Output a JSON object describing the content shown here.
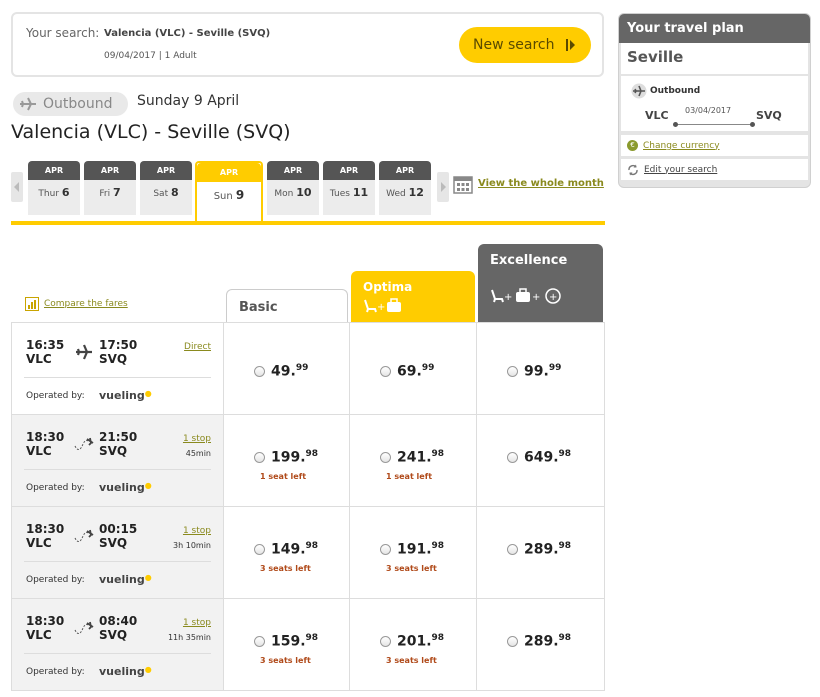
{
  "search": {
    "label": "Your search:",
    "route": "Valencia (VLC) - Seville (SVQ)",
    "meta": "09/04/2017 | 1 Adult",
    "new_search": "New search"
  },
  "outbound": {
    "pill": "Outbound",
    "date": "Sunday 9 April",
    "route_title": "Valencia (VLC) - Seville (SVQ)"
  },
  "days": [
    {
      "mon": "APR",
      "day": "Thur",
      "num": "6"
    },
    {
      "mon": "APR",
      "day": "Fri",
      "num": "7"
    },
    {
      "mon": "APR",
      "day": "Sat",
      "num": "8"
    },
    {
      "mon": "APR",
      "day": "Sun",
      "num": "9"
    },
    {
      "mon": "APR",
      "day": "Mon",
      "num": "10"
    },
    {
      "mon": "APR",
      "day": "Tues",
      "num": "11"
    },
    {
      "mon": "APR",
      "day": "Wed",
      "num": "12"
    }
  ],
  "whole_month": "View the whole month",
  "compare_fares": "Compare the fares",
  "fares": {
    "basic": "Basic",
    "optima": "Optima",
    "excellence": "Excellence"
  },
  "operated_by": "Operated by:",
  "airline": "vueling",
  "flights": [
    {
      "dep": "16:35",
      "from": "VLC",
      "arr": "17:50",
      "to": "SVQ",
      "stops": "Direct",
      "duration": "",
      "prices": [
        {
          "int": "49.",
          "dec": "99",
          "seats": ""
        },
        {
          "int": "69.",
          "dec": "99",
          "seats": ""
        },
        {
          "int": "99.",
          "dec": "99",
          "seats": ""
        }
      ]
    },
    {
      "dep": "18:30",
      "from": "VLC",
      "arr": "21:50",
      "to": "SVQ",
      "stops": "1 stop",
      "duration": "45min",
      "prices": [
        {
          "int": "199.",
          "dec": "98",
          "seats": "1 seat left"
        },
        {
          "int": "241.",
          "dec": "98",
          "seats": "1 seat left"
        },
        {
          "int": "649.",
          "dec": "98",
          "seats": ""
        }
      ]
    },
    {
      "dep": "18:30",
      "from": "VLC",
      "arr": "00:15",
      "to": "SVQ",
      "stops": "1 stop",
      "duration": "3h 10min",
      "prices": [
        {
          "int": "149.",
          "dec": "98",
          "seats": "3 seats left"
        },
        {
          "int": "191.",
          "dec": "98",
          "seats": "3 seats left"
        },
        {
          "int": "289.",
          "dec": "98",
          "seats": ""
        }
      ]
    },
    {
      "dep": "18:30",
      "from": "VLC",
      "arr": "08:40",
      "to": "SVQ",
      "stops": "1 stop",
      "duration": "11h 35min",
      "prices": [
        {
          "int": "159.",
          "dec": "98",
          "seats": "3 seats left"
        },
        {
          "int": "201.",
          "dec": "98",
          "seats": "3 seats left"
        },
        {
          "int": "289.",
          "dec": "98",
          "seats": ""
        }
      ]
    }
  ],
  "plan": {
    "title": "Your travel plan",
    "city": "Seville",
    "outbound": "Outbound",
    "from": "VLC",
    "to": "SVQ",
    "date": "03/04/2017",
    "currency": "Change currency",
    "edit": "Edit your search"
  },
  "colors": {
    "accent": "#ffcc00",
    "dark": "#666666",
    "link": "#8a8a1e",
    "warn": "#b04a1a"
  }
}
